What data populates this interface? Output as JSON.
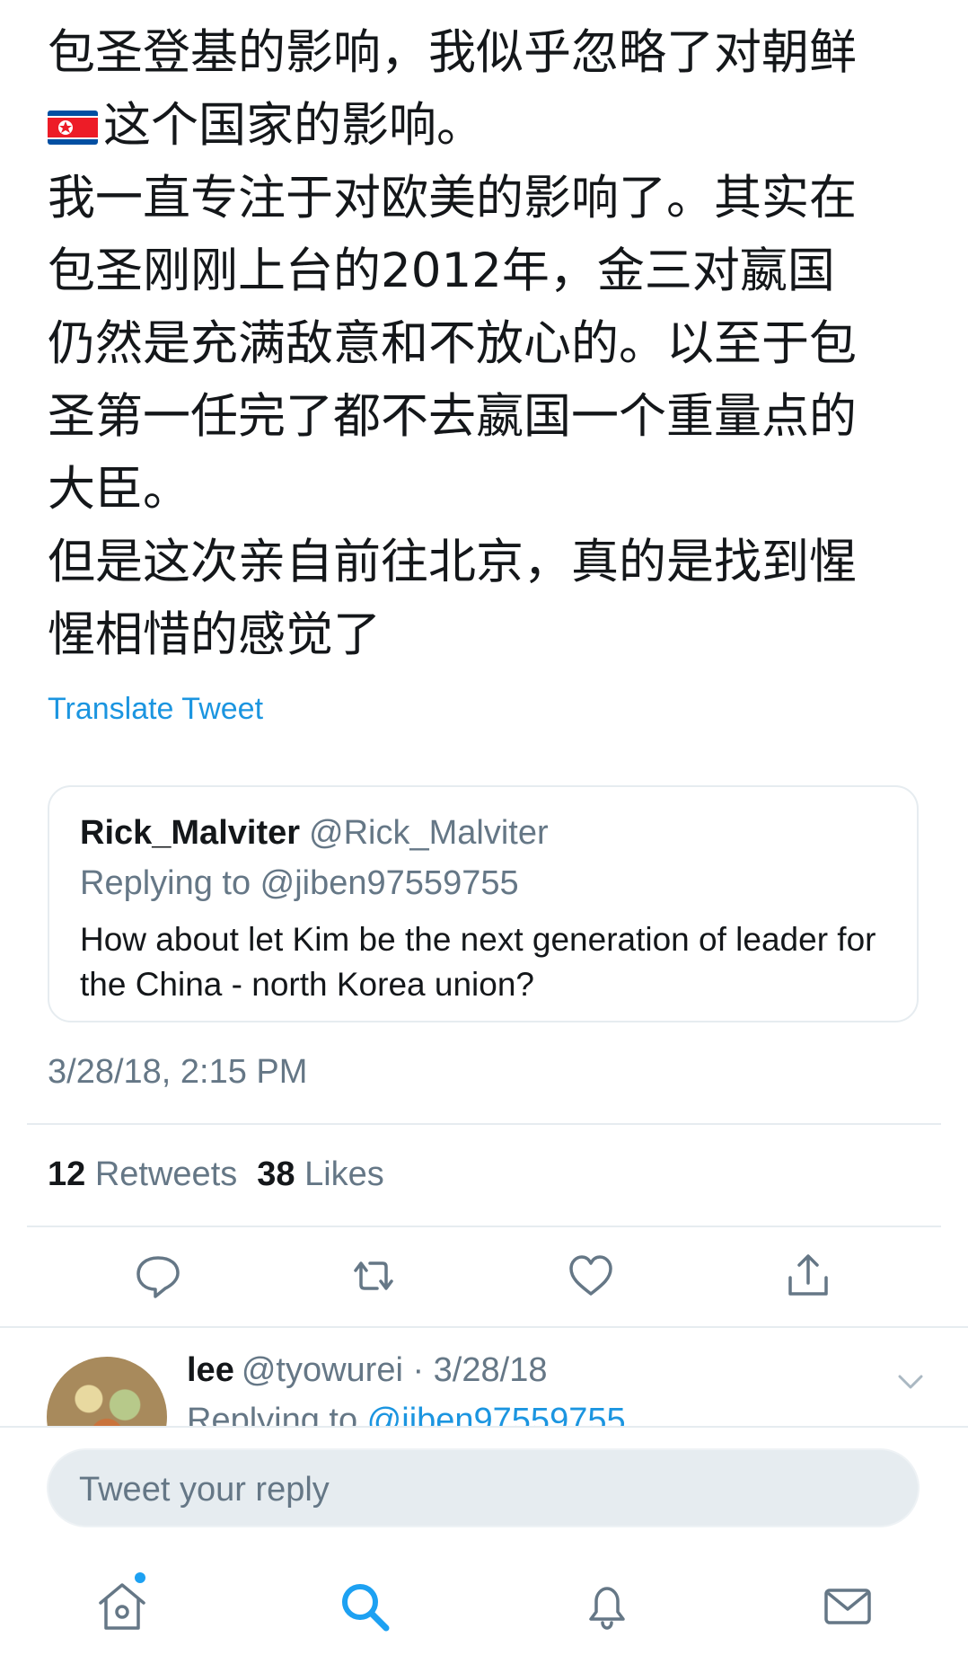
{
  "tweet": {
    "lines": [
      "包圣登基的影响，我似乎忽略了对朝鲜",
      "这个国家的影响。",
      "我一直专注于对欧美的影响了。其实在",
      "包圣刚刚上台的2012年，金三对嬴国",
      "仍然是充满敌意和不放心的。以至于包",
      "圣第一任完了都不去嬴国一个重量点的",
      "大臣。",
      "但是这次亲自前往北京，真的是找到惺",
      "惺相惜的感觉了"
    ],
    "flag_icon": "north-korea-flag-emoji",
    "translate_label": "Translate Tweet"
  },
  "quoted": {
    "name": "Rick_Malviter",
    "handle": "@Rick_Malviter",
    "replying_to": "Replying to @jiben97559755",
    "text": "How about let Kim be the next generation of leader for the China - north Korea union?"
  },
  "timestamp": "3/28/18, 2:15 PM",
  "stats": {
    "retweets_count": "12",
    "retweets_label": "Retweets",
    "likes_count": "38",
    "likes_label": "Likes"
  },
  "actions": {
    "icons": [
      "reply-icon",
      "retweet-icon",
      "like-icon",
      "share-icon"
    ]
  },
  "reply": {
    "name": "lee",
    "meta": "@tyowurei · 3/28/18",
    "replying_prefix": "Replying to ",
    "replying_handle": "@jiben97559755"
  },
  "composer": {
    "placeholder": "Tweet your reply"
  },
  "tabbar": {
    "icons": [
      "home-icon",
      "search-icon",
      "notifications-icon",
      "messages-icon"
    ]
  },
  "colors": {
    "accent": "#1da1f2",
    "link": "#1b95e0",
    "secondary_text": "#657786",
    "divider": "#e6ecf0"
  }
}
